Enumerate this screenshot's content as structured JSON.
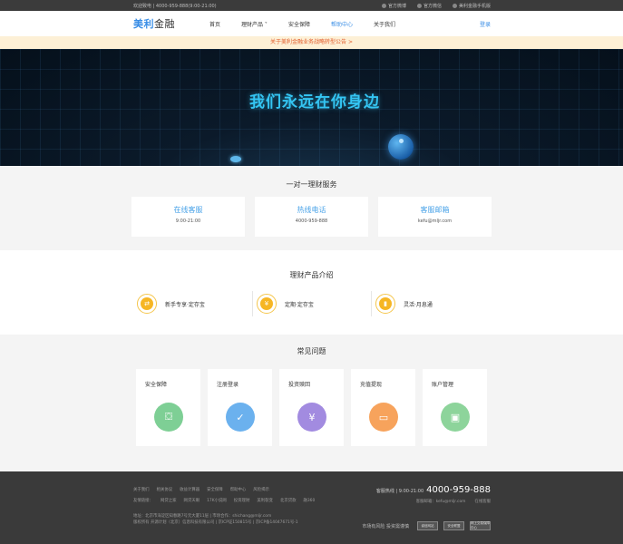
{
  "topbar": {
    "hotline": "欢迎致电 | 4000-959-888(9:00-21:00)",
    "links": [
      "官方微博",
      "官方微信",
      "美利金融手机版"
    ]
  },
  "nav": {
    "logo_a": "美利",
    "logo_b": "金融",
    "items": [
      "首页",
      "理财产品 ˅",
      "安全保障",
      "帮助中心",
      "关于我们"
    ],
    "active_index": 3,
    "login": "登录"
  },
  "notice": "关于美利金融业务战略转型公告 >",
  "banner": {
    "slogan": "我们永远在你身边"
  },
  "service": {
    "title": "一对一理财服务",
    "cards": [
      {
        "title": "在线客服",
        "sub": "9:00-21:00"
      },
      {
        "title": "热线电话",
        "sub": "4000-959-888"
      },
      {
        "title": "客服邮箱",
        "sub": "kefu@mljr.com"
      }
    ]
  },
  "products": {
    "title": "理财产品介绍",
    "items": [
      {
        "label": "新手专享·定存宝",
        "icon": "exchange-icon",
        "glyph": "⇄"
      },
      {
        "label": "定期·定存宝",
        "icon": "yen-icon",
        "glyph": "¥"
      },
      {
        "label": "灵活·月息通",
        "icon": "bar-chart-icon",
        "glyph": "▮"
      }
    ]
  },
  "faq": {
    "title": "常见问题",
    "items": [
      {
        "label": "安全保障",
        "color": "#7ecf95",
        "glyph": "⛋"
      },
      {
        "label": "注册登录",
        "color": "#6bb1ee",
        "glyph": "✓"
      },
      {
        "label": "投资赎回",
        "color": "#a28be0",
        "glyph": "¥"
      },
      {
        "label": "充值提现",
        "color": "#f7a35c",
        "glyph": "▭"
      },
      {
        "label": "账户管理",
        "color": "#8dd49b",
        "glyph": "▣"
      }
    ]
  },
  "footer": {
    "links1": [
      "关于我们",
      "相关协议",
      "收益计算器",
      "安全保障",
      "帮助中心",
      "风险揭示"
    ],
    "links2": [
      "友情链接：",
      "网贷之家",
      "网贷天眼",
      "17K小说网",
      "投资理财",
      "美利裂变",
      "北京贷款",
      "融360"
    ],
    "hotline_label": "客服热线 | 9:00-21:00",
    "hotline": "4000-959-888",
    "mail": "客服邮箱：kefu@mljr.com",
    "online": "在线客服",
    "address": "地址：北京市海淀区知春路7号元大厦11层 | 市场合作：shichang@mljr.com",
    "copyright": "版权所有 开源计划（北京）信息科技有限公司 | 京ICP证150815号 | 京ICP备14047671号-1",
    "risk": "市场有风险 投资需谨慎",
    "badges": [
      "诚信网站",
      "安全联盟",
      "网上交易保障中心"
    ]
  }
}
